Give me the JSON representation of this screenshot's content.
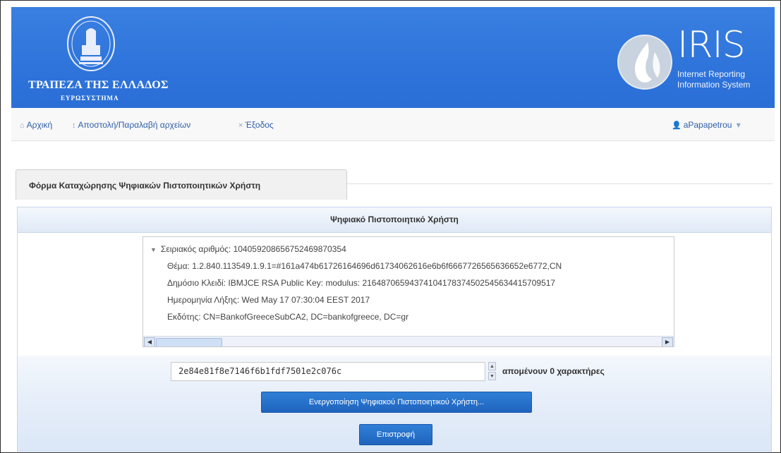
{
  "header": {
    "bank_name": "ΤΡΑΠΕΖΑ ΤΗΣ ΕΛΛΑΔΟΣ",
    "bank_subtitle": "ΕΥΡΩΣΥΣΤΗΜΑ",
    "logo_icon": "bank-seal-icon",
    "iris_logo_icon": "iris-drop-logo-icon",
    "iris_title": "IRIS",
    "iris_subtitle_line1": "Internet Reporting",
    "iris_subtitle_line2": "Information System",
    "banner_color": "#2e74db"
  },
  "nav": {
    "home": {
      "icon": "home-icon",
      "label": "Αρχική"
    },
    "files": {
      "icon": "transfer-icon",
      "label": "Αποστολή/Παραλαβή αρχείων"
    },
    "logout": {
      "icon": "close-icon",
      "label": "Έξοδος"
    },
    "user": {
      "icon": "user-icon",
      "label": "aPapapetrou",
      "chevron": "▾"
    }
  },
  "form": {
    "tab_title": "Φόρμα Καταχώρησης Ψηφιακών Πιστοποιητικών Χρήστη",
    "panel_title": "Ψηφιακό Πιστοποιητικό Χρήστη",
    "certificate": {
      "serial": "Σειριακός αριθμός: 104059208656752469870354",
      "subject": "Θέμα: 1.2.840.113549.1.9.1=#161a474b61726164696d61734062616e6b6f6667726565636652e6772,CN",
      "public_key": "Δημόσιο Κλειδί: IBMJCE RSA Public Key: modulus: 21648706594374104178374502545634415709517",
      "expiry": "Ημερομηνία Λήξης: Wed May 17 07:30:04 EEST 2017",
      "issuer": "Εκδότης: CN=BankofGreeceSubCA2, DC=bankofgreece, DC=gr"
    },
    "input_value": "2e84e81f8e7146f6b1fdf7501e2c076c",
    "remaining_text": "απομένουν 0 χαρακτήρες",
    "activate_button": "Ενεργοποίηση Ψηφιακού Πιστοποιητικού Χρήστη...",
    "back_button": "Επιστροφή"
  }
}
